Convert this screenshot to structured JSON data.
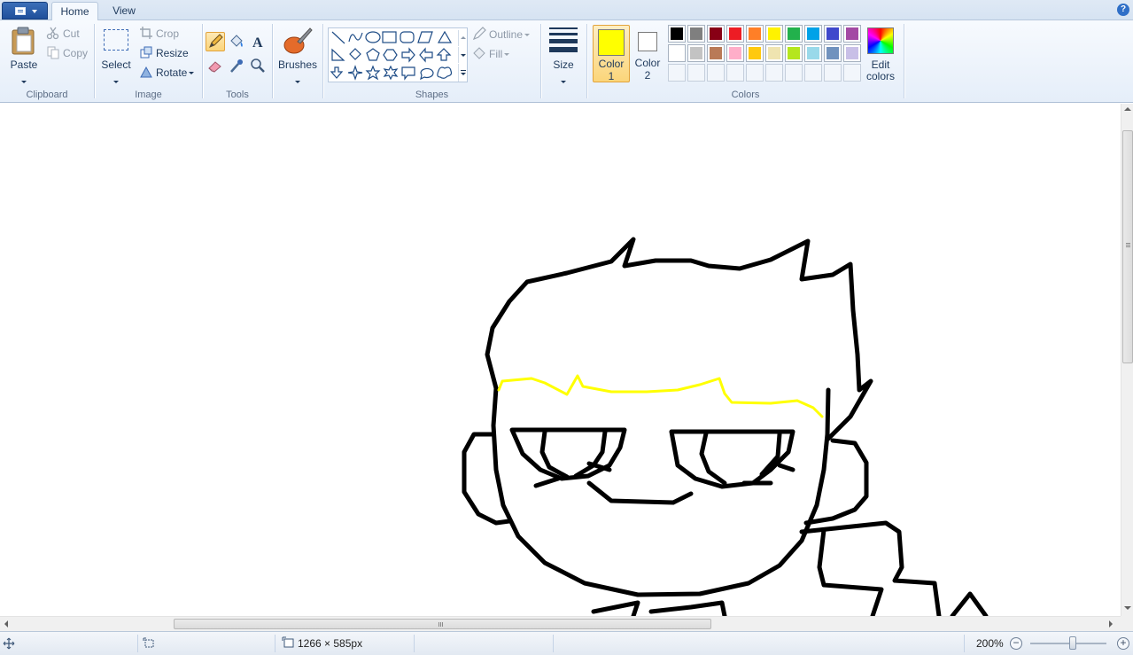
{
  "tabs": {
    "home": "Home",
    "view": "View"
  },
  "help": "?",
  "clipboard": {
    "paste": "Paste",
    "cut": "Cut",
    "copy": "Copy",
    "group": "Clipboard"
  },
  "image": {
    "select": "Select",
    "crop": "Crop",
    "resize": "Resize",
    "rotate": "Rotate",
    "group": "Image"
  },
  "tools": {
    "group": "Tools",
    "active_tool": "pencil"
  },
  "brushes": {
    "label": "Brushes"
  },
  "shapes": {
    "outline": "Outline",
    "fill": "Fill",
    "group": "Shapes"
  },
  "size": {
    "label": "Size"
  },
  "colors": {
    "color1_label": "Color",
    "color1_num": "1",
    "color2_label": "Color",
    "color2_num": "2",
    "color1_value": "#ffff00",
    "color2_value": "#ffffff",
    "edit_line1": "Edit",
    "edit_line2": "colors",
    "group": "Colors",
    "palette_row1": [
      "#000000",
      "#7f7f7f",
      "#880015",
      "#ed1c24",
      "#ff7f27",
      "#fff200",
      "#22b14c",
      "#00a2e8",
      "#3f48cc",
      "#a349a4"
    ],
    "palette_row2": [
      "#ffffff",
      "#c3c3c3",
      "#b97a57",
      "#ffaec9",
      "#ffc90e",
      "#efe4b0",
      "#b5e61d",
      "#99d9ea",
      "#7092be",
      "#c8bfe7"
    ]
  },
  "status": {
    "dimensions": "1266 × 585px",
    "zoom": "200%"
  }
}
